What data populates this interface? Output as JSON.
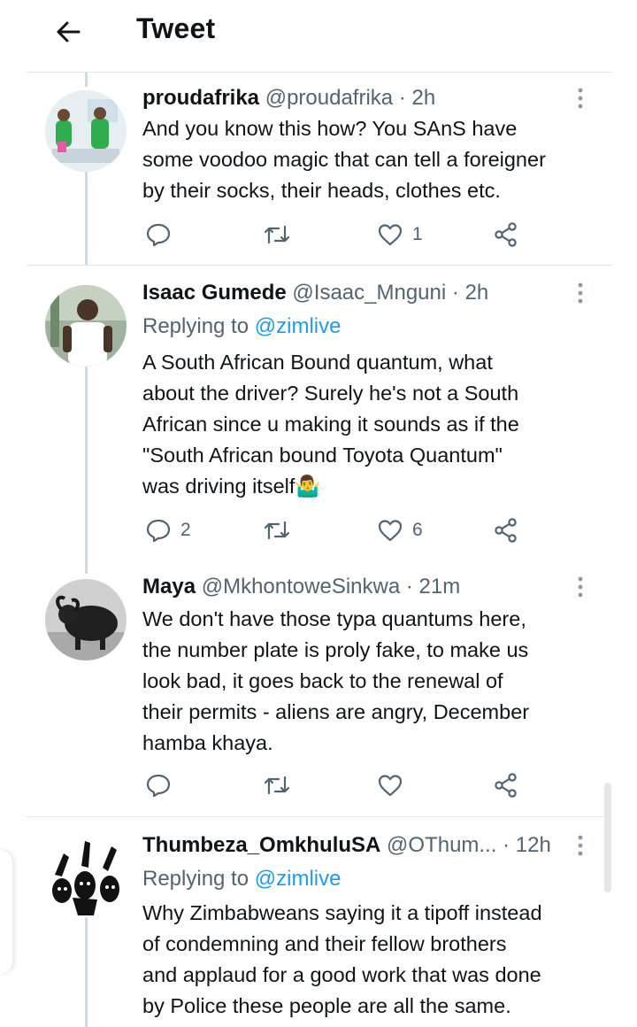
{
  "header": {
    "title": "Tweet"
  },
  "tweets": [
    {
      "name": "proudafrika",
      "handle": "@proudafrika",
      "time": "2h",
      "reply_label": "",
      "reply_to": "",
      "lines": [
        "And you know this how? You SAnS have",
        "some voodoo magic that can tell a foreigner",
        "by their socks, their heads, clothes etc."
      ],
      "replies": "",
      "retweets": "",
      "likes": "1"
    },
    {
      "name": "Isaac Gumede",
      "handle": "@Isaac_Mnguni",
      "time": "2h",
      "reply_label": "Replying to",
      "reply_to": "@zimlive",
      "lines": [
        "A South African Bound quantum, what",
        "about the driver? Surely he's not a South",
        "African since u making it sounds as if the",
        "\"South African bound Toyota Quantum\"",
        "was driving itself🤷‍♂️"
      ],
      "replies": "2",
      "retweets": "",
      "likes": "6"
    },
    {
      "name": "Maya",
      "handle": "@MkhontoweSinkwa",
      "time": "21m",
      "reply_label": "",
      "reply_to": "",
      "lines": [
        "We don't have those typa quantums here,",
        "the number plate is proly fake, to make us",
        "look bad, it goes back to the renewal of",
        "their permits  - aliens are angry, December",
        "hamba khaya."
      ],
      "replies": "",
      "retweets": "",
      "likes": ""
    },
    {
      "name": "Thumbeza_OmkhuluSA",
      "handle": "@OThum...",
      "time": "12h",
      "reply_label": "Replying to",
      "reply_to": "@zimlive",
      "lines": [
        "Why Zimbabweans saying it a tipoff instead",
        "of condemning and their fellow brothers",
        "and applaud for a good work that was done",
        "by Police these people are all the same."
      ]
    }
  ],
  "icons": {
    "back": "arrow-left-icon",
    "reply": "reply-icon",
    "retweet": "retweet-icon",
    "like": "heart-icon",
    "share": "share-icon",
    "more": "more-vertical-icon"
  },
  "colors": {
    "link": "#1d9bf0",
    "muted": "#536471",
    "text": "#0f1419"
  }
}
